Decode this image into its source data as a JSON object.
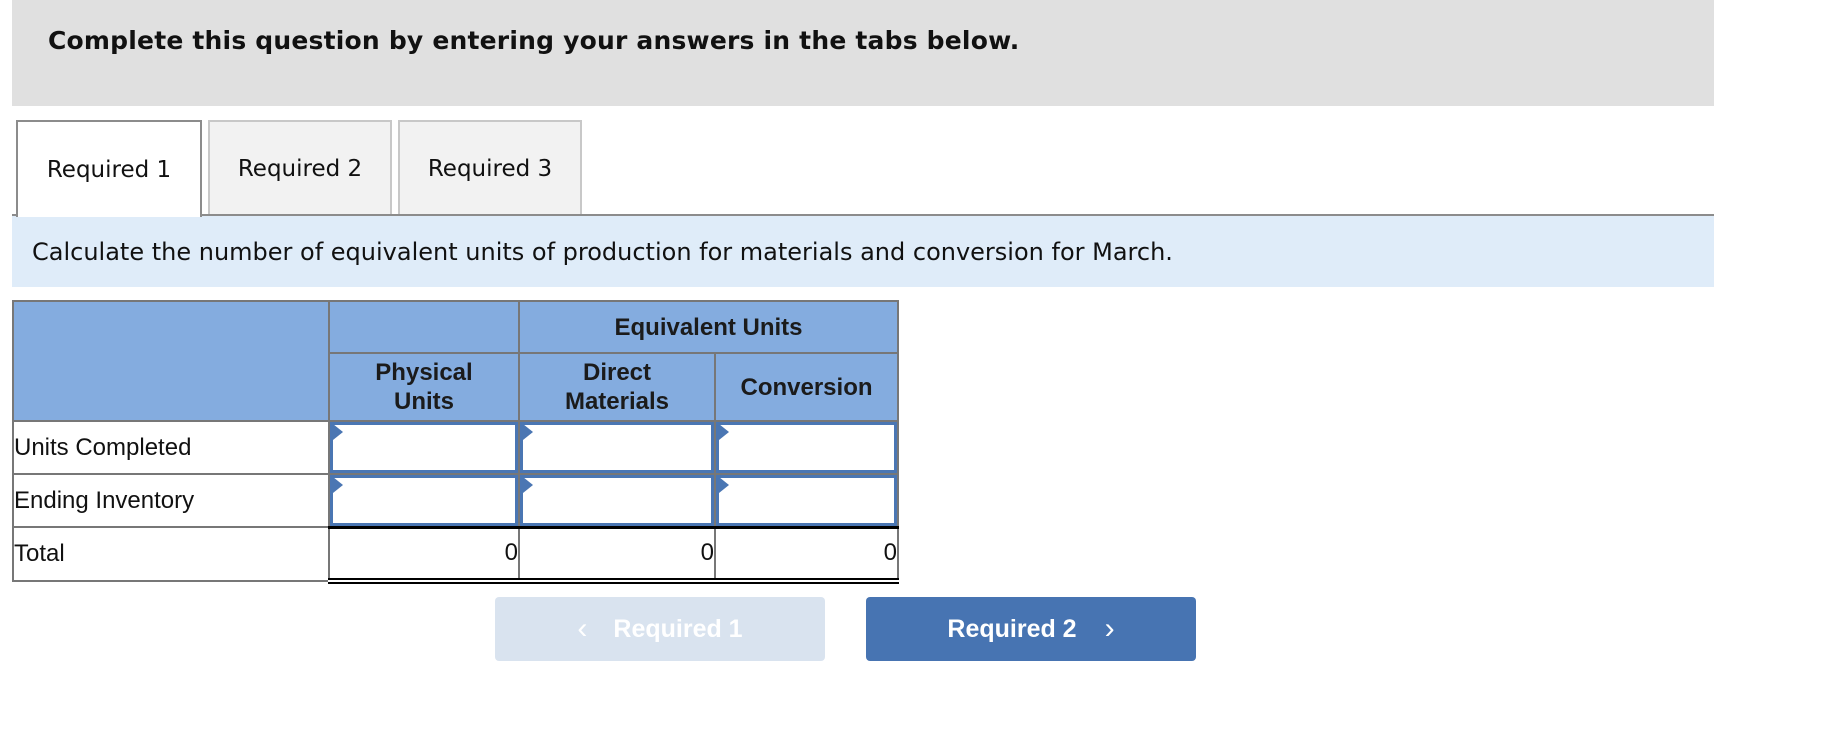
{
  "instructions": "Complete this question by entering your answers in the tabs below.",
  "tabs": [
    {
      "label": "Required 1",
      "active": true
    },
    {
      "label": "Required 2",
      "active": false
    },
    {
      "label": "Required 3",
      "active": false
    }
  ],
  "prompt": "Calculate the number of equivalent units of production for materials and conversion for March.",
  "table": {
    "group_header": "Equivalent Units",
    "columns": [
      "Physical Units",
      "Direct Materials",
      "Conversion"
    ],
    "column_lines": [
      [
        "Physical",
        "Units"
      ],
      [
        "Direct",
        "Materials"
      ],
      [
        "Conversion"
      ]
    ],
    "rows": [
      {
        "label": "Units Completed",
        "values": [
          "",
          "",
          ""
        ]
      },
      {
        "label": "Ending Inventory",
        "values": [
          "",
          "",
          ""
        ]
      }
    ],
    "total": {
      "label": "Total",
      "values": [
        "0",
        "0",
        "0"
      ]
    }
  },
  "nav": {
    "prev_label": "Required 1",
    "prev_enabled": false,
    "next_label": "Required 2",
    "next_enabled": true,
    "prev_icon": "‹",
    "next_icon": "›"
  },
  "colors": {
    "header_blue": "#84acdf",
    "accent_blue": "#4774b2",
    "prompt_bg": "#dfecf9",
    "instructions_bg": "#e0e0e0"
  }
}
